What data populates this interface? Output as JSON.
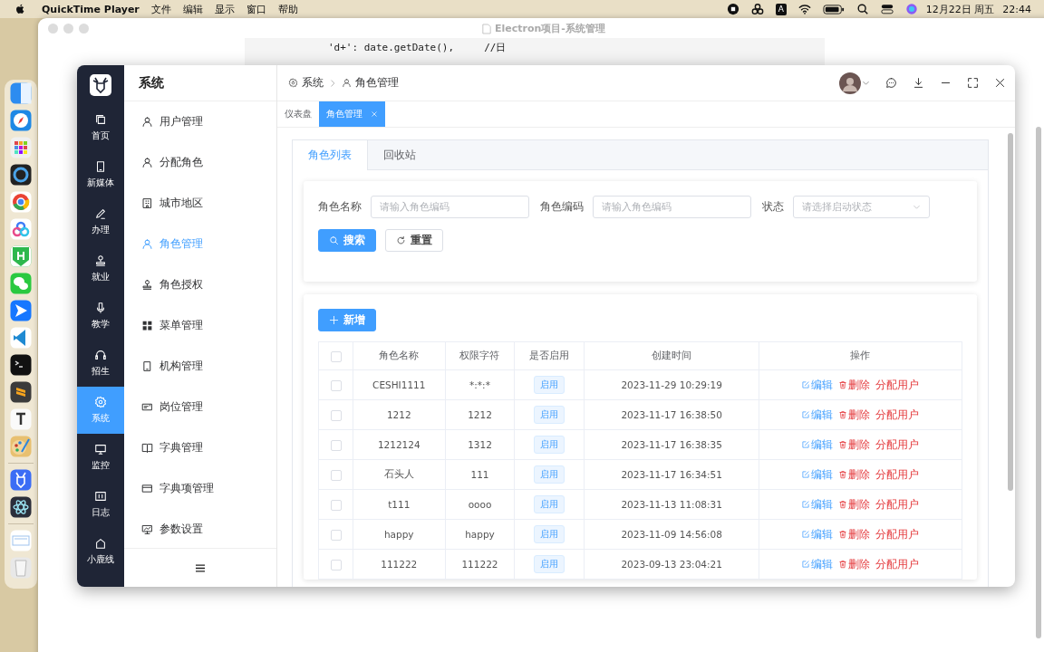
{
  "menubar": {
    "app": "QuickTime Player",
    "menus": [
      "文件",
      "编辑",
      "显示",
      "窗口",
      "帮助"
    ],
    "input_source": "A",
    "date": "12月22日 周五",
    "time": "22:44"
  },
  "background_window": {
    "title": "Electron项目-系统管理",
    "code_lines": [
      "'d+': date.getDate(),     //日"
    ]
  },
  "app": {
    "rail": [
      {
        "label": "首页",
        "selected": false
      },
      {
        "label": "新媒体",
        "selected": false
      },
      {
        "label": "办理",
        "selected": false
      },
      {
        "label": "就业",
        "selected": false
      },
      {
        "label": "教学",
        "selected": false
      },
      {
        "label": "招生",
        "selected": false
      },
      {
        "label": "系统",
        "selected": true
      },
      {
        "label": "监控",
        "selected": false
      },
      {
        "label": "日志",
        "selected": false
      },
      {
        "label": "小鹿线",
        "selected": false
      }
    ],
    "section_title": "系统",
    "menu": [
      {
        "label": "用户管理",
        "selected": false
      },
      {
        "label": "分配角色",
        "selected": false
      },
      {
        "label": "城市地区",
        "selected": false
      },
      {
        "label": "角色管理",
        "selected": true
      },
      {
        "label": "角色授权",
        "selected": false
      },
      {
        "label": "菜单管理",
        "selected": false
      },
      {
        "label": "机构管理",
        "selected": false
      },
      {
        "label": "岗位管理",
        "selected": false
      },
      {
        "label": "字典管理",
        "selected": false
      },
      {
        "label": "字典项管理",
        "selected": false
      },
      {
        "label": "参数设置",
        "selected": false
      }
    ],
    "breadcrumb": [
      "系统",
      "角色管理"
    ],
    "page_tabs": [
      {
        "label": "仪表盘",
        "selected": false,
        "closable": false
      },
      {
        "label": "角色管理",
        "selected": true,
        "closable": true
      }
    ],
    "inner_tabs": [
      {
        "label": "角色列表",
        "selected": true
      },
      {
        "label": "回收站",
        "selected": false
      }
    ],
    "filters": [
      {
        "label": "角色名称",
        "placeholder": "请输入角色编码",
        "kind": "input"
      },
      {
        "label": "角色编码",
        "placeholder": "请输入角色编码",
        "kind": "input"
      },
      {
        "label": "状态",
        "placeholder": "请选择启动状态",
        "kind": "select"
      }
    ],
    "search_button": "搜索",
    "reset_button": "重置",
    "add_button": "新增",
    "table": {
      "all_checked": false,
      "columns": [
        "角色名称",
        "权限字符",
        "是否启用",
        "创建时间",
        "操作"
      ],
      "rows": [
        {
          "checked": false,
          "name": "CESHI1111",
          "key": "*:*:*",
          "status": "启用",
          "created": "2023-11-29 10:29:19",
          "actions": [
            {
              "label": "编辑",
              "kind": "edit"
            },
            {
              "label": "删除",
              "kind": "delete"
            },
            {
              "label": "分配用户",
              "kind": "assign"
            }
          ]
        },
        {
          "checked": false,
          "name": "1212",
          "key": "1212",
          "status": "启用",
          "created": "2023-11-17 16:38:50",
          "actions": [
            {
              "label": "编辑",
              "kind": "edit"
            },
            {
              "label": "删除",
              "kind": "delete"
            },
            {
              "label": "分配用户",
              "kind": "assign"
            }
          ]
        },
        {
          "checked": false,
          "name": "1212124",
          "key": "1312",
          "status": "启用",
          "created": "2023-11-17 16:38:35",
          "actions": [
            {
              "label": "编辑",
              "kind": "edit"
            },
            {
              "label": "删除",
              "kind": "delete"
            },
            {
              "label": "分配用户",
              "kind": "assign"
            }
          ]
        },
        {
          "checked": false,
          "name": "石头人",
          "key": "111",
          "status": "启用",
          "created": "2023-11-17 16:34:51",
          "actions": [
            {
              "label": "编辑",
              "kind": "edit"
            },
            {
              "label": "删除",
              "kind": "delete"
            },
            {
              "label": "分配用户",
              "kind": "assign"
            }
          ]
        },
        {
          "checked": false,
          "name": "t111",
          "key": "oooo",
          "status": "启用",
          "created": "2023-11-13 11:08:31",
          "actions": [
            {
              "label": "编辑",
              "kind": "edit"
            },
            {
              "label": "删除",
              "kind": "delete"
            },
            {
              "label": "分配用户",
              "kind": "assign"
            }
          ]
        },
        {
          "checked": false,
          "name": "happy",
          "key": "happy",
          "status": "启用",
          "created": "2023-11-09 14:56:08",
          "actions": [
            {
              "label": "编辑",
              "kind": "edit"
            },
            {
              "label": "删除",
              "kind": "delete"
            },
            {
              "label": "分配用户",
              "kind": "assign"
            }
          ]
        },
        {
          "checked": false,
          "name": "111222",
          "key": "111222",
          "status": "启用",
          "created": "2023-09-13 23:04:21",
          "actions": [
            {
              "label": "编辑",
              "kind": "edit"
            },
            {
              "label": "删除",
              "kind": "delete"
            },
            {
              "label": "分配用户",
              "kind": "assign"
            }
          ]
        }
      ]
    }
  }
}
